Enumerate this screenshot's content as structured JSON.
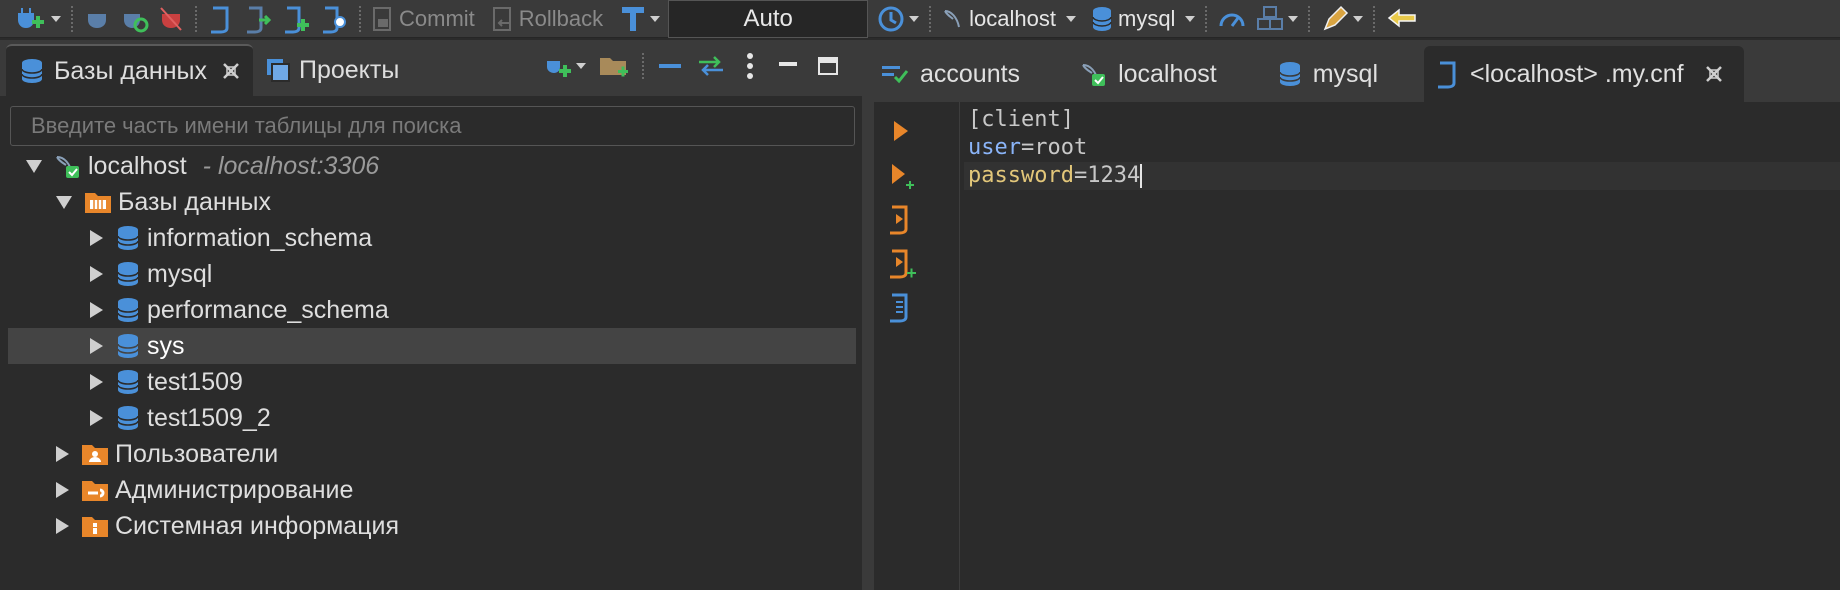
{
  "toolbar": {
    "commit_label": "Commit",
    "rollback_label": "Rollback",
    "transaction_mode": "Auto",
    "connection_label": "localhost",
    "database_label": "mysql"
  },
  "left_panel": {
    "tabs": [
      {
        "label": "Базы данных"
      },
      {
        "label": "Проекты"
      }
    ],
    "search_placeholder": "Введите часть имени таблицы для поиска",
    "tree": {
      "connection": {
        "name": "localhost",
        "info": "- localhost:3306"
      },
      "databases_folder": "Базы данных",
      "databases": [
        "information_schema",
        "mysql",
        "performance_schema",
        "sys",
        "test1509",
        "test1509_2"
      ],
      "selected": "sys",
      "folders": [
        "Пользователи",
        "Администрирование",
        "Системная информация"
      ]
    }
  },
  "right_panel": {
    "tabs": [
      {
        "label": "accounts"
      },
      {
        "label": "localhost"
      },
      {
        "label": "mysql"
      },
      {
        "label": "<localhost> .my.cnf"
      }
    ],
    "code": {
      "line1": "[client]",
      "line2_key": "user",
      "line2_val": "=root",
      "line3_key": "password",
      "line3_val": "=1234"
    }
  },
  "colors": {
    "background": "#2b2b2b",
    "toolbar": "#3a3a3a",
    "accent_blue": "#4a90d9",
    "accent_orange": "#e8862a",
    "accent_green": "#3fbf5a"
  }
}
